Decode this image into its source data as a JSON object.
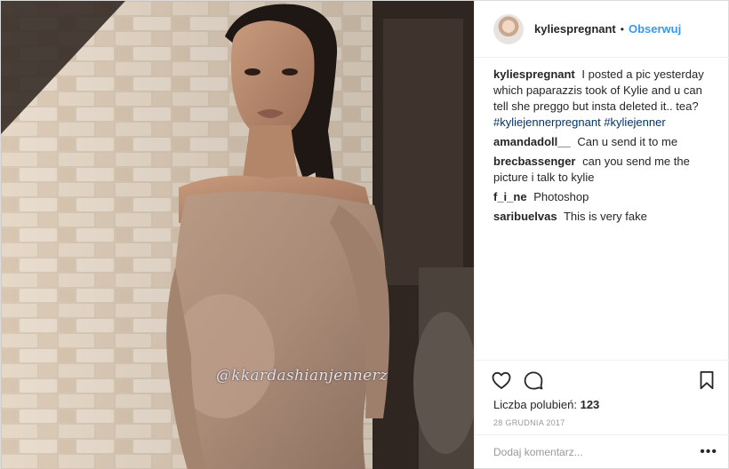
{
  "post": {
    "username": "kyliespregnant",
    "follow_label": "Obserwuj",
    "separator": "•",
    "watermark": "@kkardashianjennerz",
    "caption": {
      "user": "kyliespregnant",
      "text": "I posted a pic yesterday which paparazzis took of Kylie and u can tell she preggo but insta deleted it.. tea?",
      "hashtags": "#kyliejennerpregnant #kyliejenner"
    },
    "comments": [
      {
        "user": "amandadoll__",
        "text": "Can u send it to me"
      },
      {
        "user": "brecbassenger",
        "text": "can you send me the picture i talk to kylie"
      },
      {
        "user": "f_i_ne",
        "text": "Photoshop"
      },
      {
        "user": "saribuelvas",
        "text": "This is very fake"
      }
    ],
    "likes_label": "Liczba polubień:",
    "likes_count": "123",
    "date": "28 grudnia 2017",
    "add_comment_placeholder": "Dodaj komentarz...",
    "more_label": "•••"
  },
  "icons": {
    "like": "heart-icon",
    "comment": "comment-bubble-icon",
    "save": "bookmark-icon"
  }
}
